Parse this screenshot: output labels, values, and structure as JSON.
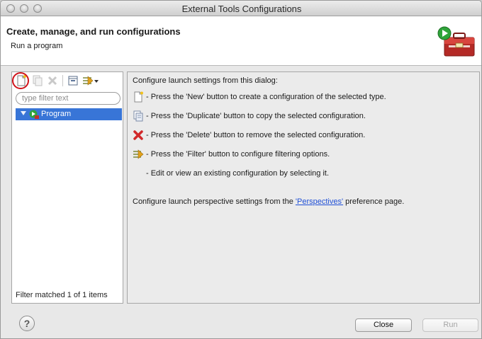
{
  "window": {
    "title": "External Tools Configurations"
  },
  "header": {
    "title": "Create, manage, and run configurations",
    "subtitle": "Run a program",
    "banner_icon": "toolbox-run-icon"
  },
  "left_panel": {
    "toolbar_icons": [
      "new-config-icon",
      "duplicate-icon",
      "delete-icon",
      "collapse-all-icon",
      "filter-icon",
      "dropdown-arrow-icon"
    ],
    "filter_placeholder": "type filter text",
    "filter_value": "",
    "tree": [
      {
        "label": "Program",
        "expanded": true,
        "selected": true,
        "icon": "program-icon"
      }
    ],
    "status": "Filter matched 1 of 1 items"
  },
  "right_panel": {
    "intro": "Configure launch settings from this dialog:",
    "items": [
      {
        "icon": "new-icon",
        "text": "- Press the 'New' button to create a configuration of the selected type."
      },
      {
        "icon": "duplicate-icon",
        "text": "- Press the 'Duplicate' button to copy the selected configuration."
      },
      {
        "icon": "delete-icon",
        "text": "- Press the 'Delete' button to remove the selected configuration."
      },
      {
        "icon": "filter-icon",
        "text": "- Press the 'Filter' button to configure filtering options."
      },
      {
        "icon": "",
        "text": "- Edit or view an existing configuration by selecting it."
      }
    ],
    "perspective_before": "Configure launch perspective settings from the ",
    "perspective_link": "'Perspectives'",
    "perspective_after": " preference page."
  },
  "footer": {
    "help_label": "?",
    "close_label": "Close",
    "run_label": "Run",
    "run_enabled": false
  },
  "colors": {
    "selection": "#3875d7",
    "link": "#1f4fd6",
    "highlight_circle": "#d0141b"
  }
}
